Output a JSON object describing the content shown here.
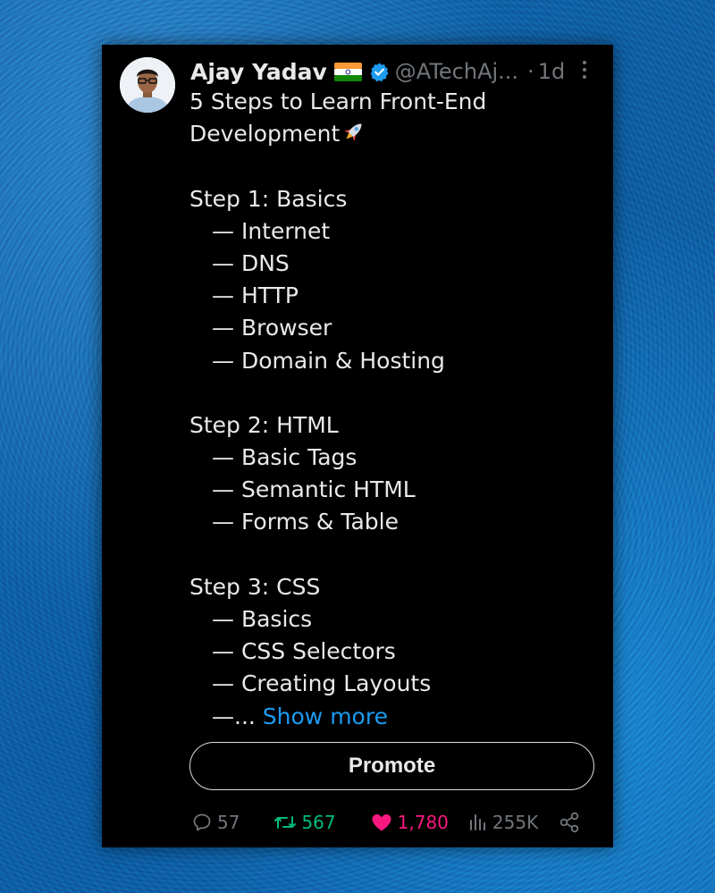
{
  "tweet": {
    "author_name": "Ajay Yadav",
    "handle": "@ATechAj...",
    "separator": "·",
    "time": "1d",
    "lines": [
      "5 Steps to Learn Front-End",
      "Development",
      "",
      "Step 1: Basics",
      "— Internet",
      "— DNS",
      "— HTTP",
      "— Browser",
      "— Domain & Hosting",
      "",
      "Step 2: HTML",
      "— Basic Tags",
      "— Semantic HTML",
      "— Forms & Table",
      "",
      "Step 3: CSS",
      "— Basics",
      "— CSS Selectors",
      "— Creating Layouts"
    ],
    "truncation": "—...",
    "show_more": "Show more",
    "promote_label": "Promote"
  },
  "metrics": {
    "replies": "57",
    "retweets": "567",
    "likes": "1,780",
    "views": "255K"
  },
  "icons": {
    "flag": "india-flag-icon",
    "verified": "verified-badge-icon",
    "rocket": "rocket-icon",
    "more": "more-options-icon",
    "reply": "reply-icon",
    "retweet": "retweet-icon",
    "like": "heart-icon",
    "views": "views-chart-icon",
    "share": "share-icon"
  },
  "colors": {
    "card_background": "#000000",
    "text": "#e7e9ea",
    "muted": "#71767b",
    "link": "#1d9bf0",
    "retweet": "#00ba7c",
    "like": "#f91880",
    "verified": "#1d9bf0"
  }
}
